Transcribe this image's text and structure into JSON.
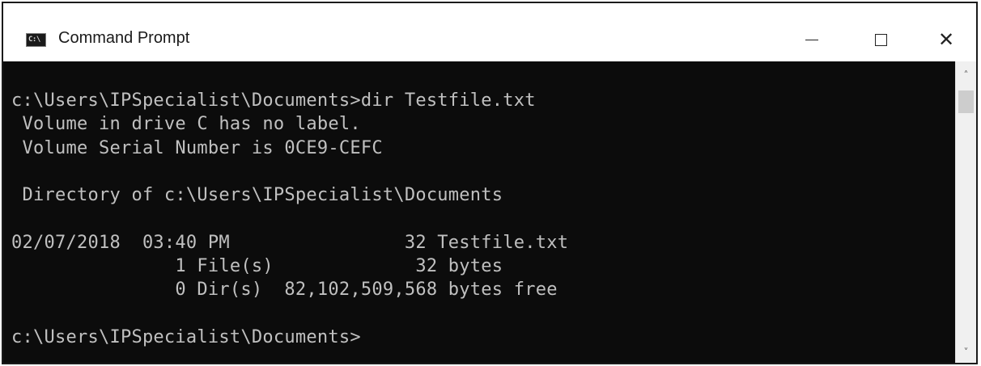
{
  "window": {
    "title": "Command Prompt",
    "icon": "cmd-icon",
    "icon_text": "C:\\",
    "controls": {
      "minimize": "minimize-icon",
      "maximize": "maximize-icon",
      "close": "close-icon",
      "close_glyph": "✕"
    }
  },
  "console": {
    "lines": [
      "c:\\Users\\IPSpecialist\\Documents>dir Testfile.txt",
      " Volume in drive C has no label.",
      " Volume Serial Number is 0CE9-CEFC",
      "",
      " Directory of c:\\Users\\IPSpecialist\\Documents",
      "",
      "02/07/2018  03:40 PM                32 Testfile.txt",
      "               1 File(s)             32 bytes",
      "               0 Dir(s)  82,102,509,568 bytes free",
      "",
      "c:\\Users\\IPSpecialist\\Documents>"
    ]
  },
  "scrollbar": {
    "up_glyph": "˄",
    "down_glyph": "˅"
  },
  "colors": {
    "console_bg": "#0c0c0c",
    "console_fg": "#c0c0c0",
    "titlebar_bg": "#ffffff"
  }
}
